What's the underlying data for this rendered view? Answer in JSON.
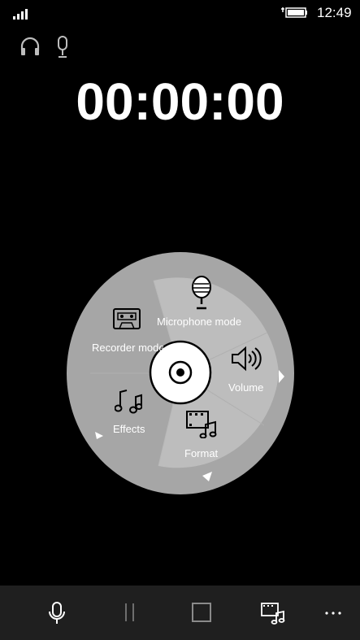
{
  "status": {
    "time": "12:49"
  },
  "timer": {
    "display": "00:00:00"
  },
  "menu": {
    "microphone_mode": "Microphone mode",
    "recorder_mode": "Recorder mode",
    "volume": "Volume",
    "effects": "Effects",
    "format": "Format"
  },
  "icons": {
    "signal": "signal-icon",
    "battery": "battery-icon",
    "headphones": "headphones-icon",
    "microphone": "microphone-icon",
    "cassette": "cassette-icon",
    "volume": "speaker-volume-icon",
    "effects": "music-notes-icon",
    "format": "film-music-icon",
    "disc": "disc-icon",
    "record": "microphone-icon",
    "pause": "pause-icon",
    "stop": "stop-icon",
    "more": "more-icon"
  },
  "colors": {
    "background": "#000000",
    "wheel_outer": "#a6a6a6",
    "wheel_inner": "#bdbdbd",
    "app_bar": "#1f1f1f"
  }
}
